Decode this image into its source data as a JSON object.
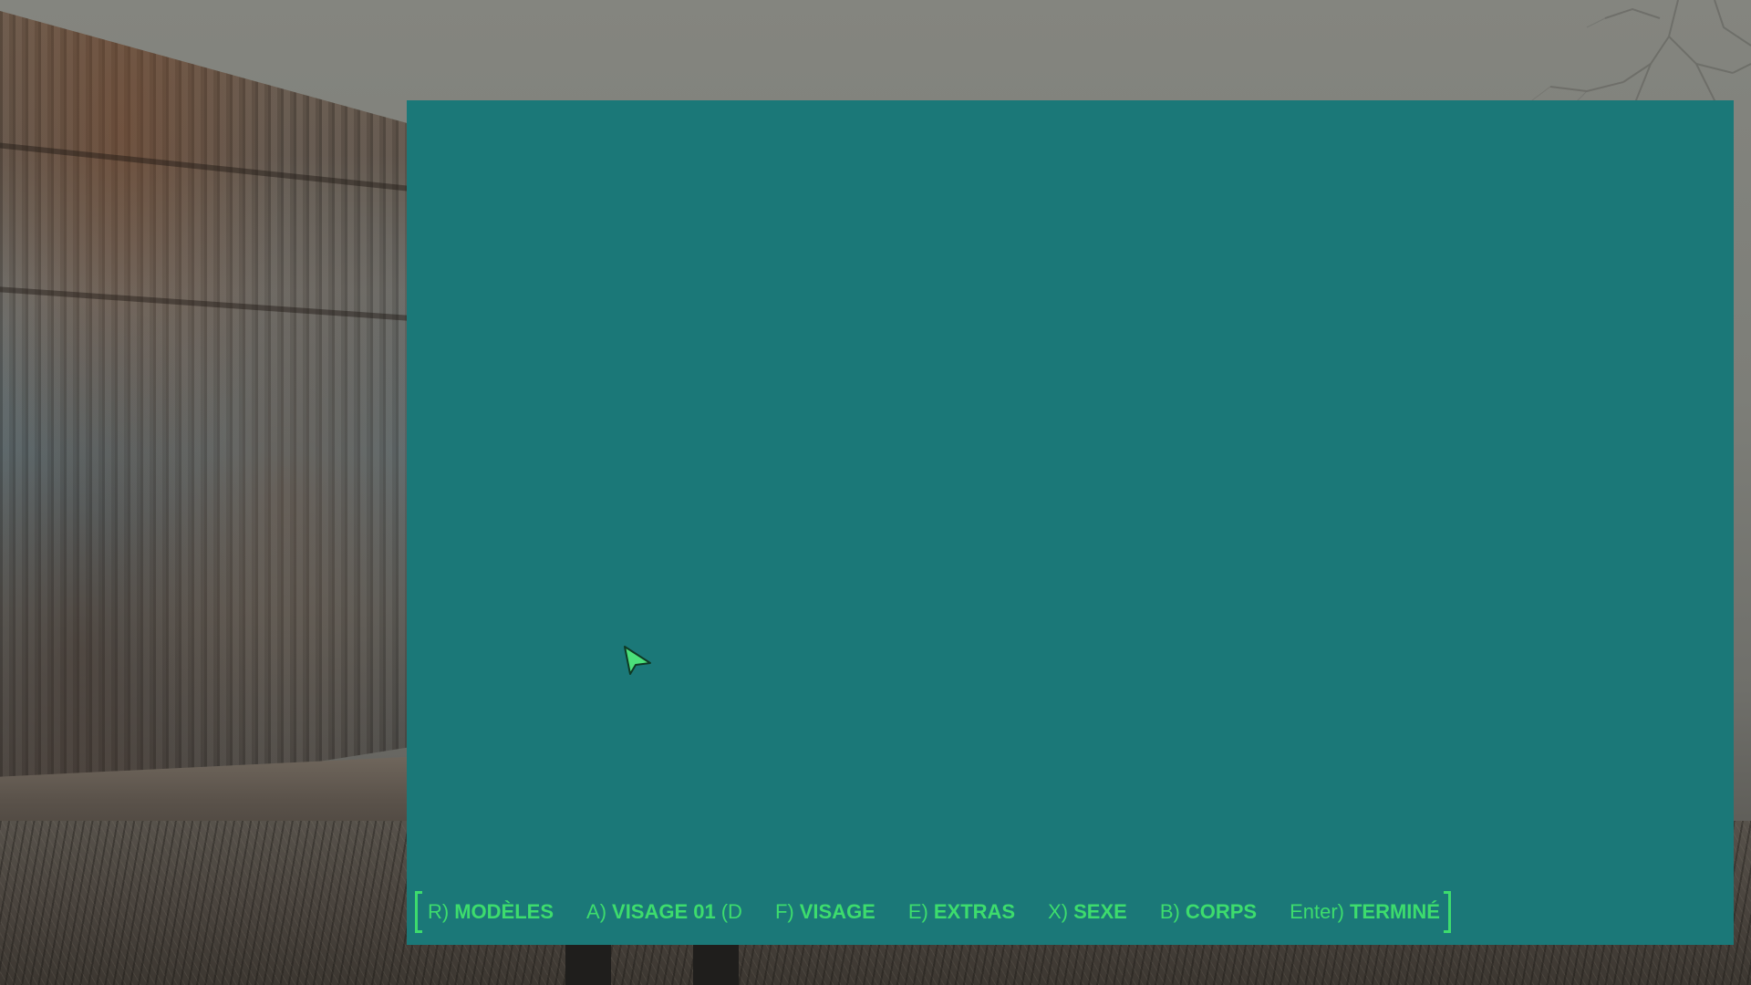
{
  "colors": {
    "panel": "#1b7878",
    "hint_text": "#3ddc6d"
  },
  "hints": [
    {
      "key": "R)",
      "label": "MODÈLES",
      "suffix": ""
    },
    {
      "key": "A)",
      "label": "VISAGE 01",
      "suffix": "(D"
    },
    {
      "key": "F)",
      "label": "VISAGE",
      "suffix": ""
    },
    {
      "key": "E)",
      "label": "EXTRAS",
      "suffix": ""
    },
    {
      "key": "X)",
      "label": "SEXE",
      "suffix": ""
    },
    {
      "key": "B)",
      "label": "CORPS",
      "suffix": ""
    },
    {
      "key": "Enter)",
      "label": "TERMINÉ",
      "suffix": ""
    }
  ],
  "cursor": {
    "icon": "pip-arrow-cursor-icon"
  }
}
